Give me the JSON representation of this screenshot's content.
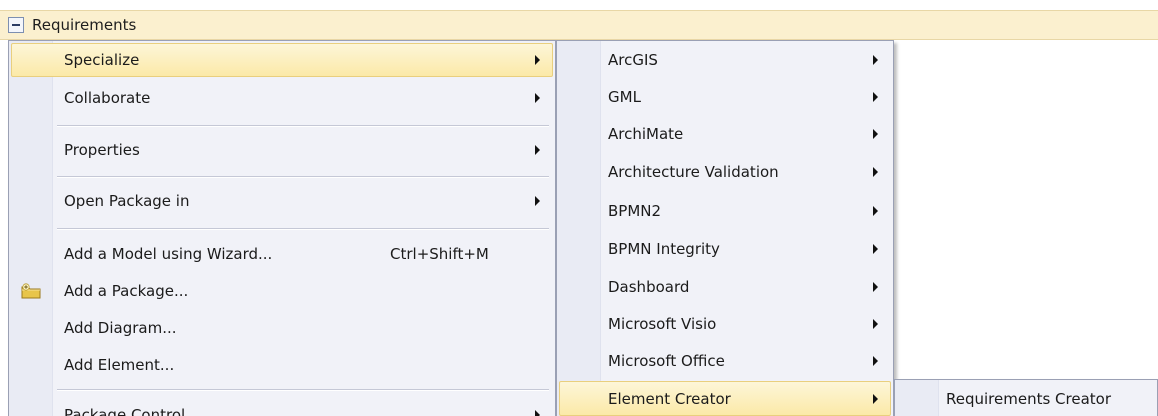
{
  "tree": {
    "title": "Requirements"
  },
  "menu1": {
    "items": [
      {
        "label": "Specialize"
      },
      {
        "label": "Collaborate"
      },
      {
        "label": "Properties"
      },
      {
        "label": "Open Package in"
      },
      {
        "label": "Add a Model using Wizard...",
        "shortcut": "Ctrl+Shift+M"
      },
      {
        "label": "Add a Package..."
      },
      {
        "label": "Add Diagram..."
      },
      {
        "label": "Add Element..."
      },
      {
        "label": "Package Control"
      }
    ]
  },
  "menu2": {
    "items": [
      {
        "label": "ArcGIS"
      },
      {
        "label": "GML"
      },
      {
        "label": "ArchiMate"
      },
      {
        "label": "Architecture Validation"
      },
      {
        "label": "BPMN2"
      },
      {
        "label": "BPMN Integrity"
      },
      {
        "label": "Dashboard"
      },
      {
        "label": "Microsoft Visio"
      },
      {
        "label": "Microsoft Office"
      },
      {
        "label": "Element Creator"
      }
    ]
  },
  "menu3": {
    "items": [
      {
        "label": "Requirements Creator"
      }
    ]
  },
  "colors": {
    "highlight": "#fbe9a8",
    "menu_bg": "#f1f2f8",
    "header_bg": "#fbf0cf"
  }
}
